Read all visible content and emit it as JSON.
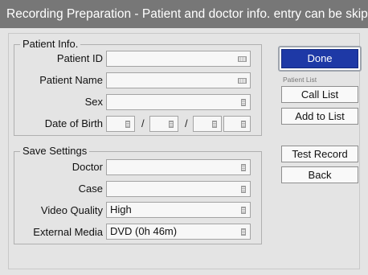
{
  "window": {
    "title": "Recording Preparation - Patient and doctor info. entry can be skipped"
  },
  "patient_info": {
    "legend": "Patient Info.",
    "patient_id_label": "Patient ID",
    "patient_id_value": "",
    "patient_name_label": "Patient Name",
    "patient_name_value": "",
    "sex_label": "Sex",
    "sex_value": "",
    "dob_label": "Date of Birth",
    "dob_separator": "/"
  },
  "save_settings": {
    "legend": "Save Settings",
    "doctor_label": "Doctor",
    "doctor_value": "",
    "case_label": "Case",
    "case_value": "",
    "video_quality_label": "Video Quality",
    "video_quality_value": "High",
    "external_media_label": "External Media",
    "external_media_value": "DVD (0h 46m)"
  },
  "actions": {
    "done": "Done",
    "patient_list_caption": "Patient List",
    "call_list": "Call List",
    "add_to_list": "Add to List",
    "test_record": "Test Record",
    "back": "Back"
  },
  "icons": {
    "keyboard": "keyboard-icon",
    "list": "list-icon"
  },
  "colors": {
    "titlebar": "#777777",
    "done_button": "#1e39a6",
    "background": "#e4e4e4"
  }
}
